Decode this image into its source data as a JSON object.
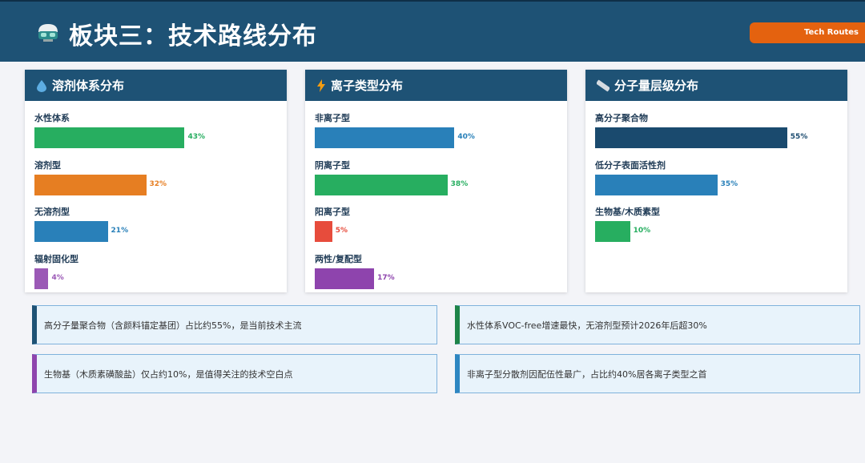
{
  "header": {
    "title": "板块三：技术路线分布",
    "badge": "Tech Routes"
  },
  "cards": [
    {
      "title": "溶剂体系分布",
      "icon": "droplet-icon",
      "items": [
        {
          "label": "水性体系",
          "value": 43,
          "pct": "43%",
          "color": "#27ae60"
        },
        {
          "label": "溶剂型",
          "value": 32,
          "pct": "32%",
          "color": "#e67e22"
        },
        {
          "label": "无溶剂型",
          "value": 21,
          "pct": "21%",
          "color": "#2980b9"
        },
        {
          "label": "辐射固化型",
          "value": 4,
          "pct": "4%",
          "color": "#9b59b6"
        }
      ]
    },
    {
      "title": "离子类型分布",
      "icon": "lightning-icon",
      "items": [
        {
          "label": "非离子型",
          "value": 40,
          "pct": "40%",
          "color": "#2980b9"
        },
        {
          "label": "阴离子型",
          "value": 38,
          "pct": "38%",
          "color": "#27ae60"
        },
        {
          "label": "阳离子型",
          "value": 5,
          "pct": "5%",
          "color": "#e74c3c"
        },
        {
          "label": "两性/复配型",
          "value": 17,
          "pct": "17%",
          "color": "#8e44ad"
        }
      ]
    },
    {
      "title": "分子量层级分布",
      "icon": "ruler-icon",
      "items": [
        {
          "label": "高分子聚合物",
          "value": 55,
          "pct": "55%",
          "color": "#1a4a6e"
        },
        {
          "label": "低分子表面活性剂",
          "value": 35,
          "pct": "35%",
          "color": "#2980b9"
        },
        {
          "label": "生物基/木质素型",
          "value": 10,
          "pct": "10%",
          "color": "#27ae60"
        }
      ]
    }
  ],
  "notes": [
    {
      "text": "高分子量聚合物（含颜料锚定基团）占比约55%，是当前技术主流",
      "color": "#1e5275"
    },
    {
      "text": "水性体系VOC-free增速最快，无溶剂型预计2026年后超30%",
      "color": "#1e8449"
    },
    {
      "text": "生物基（木质素磺酸盐）仅占约10%，是值得关注的技术空白点",
      "color": "#8e44ad"
    },
    {
      "text": "非离子型分散剂因配伍性最广，占比约40%居各离子类型之首",
      "color": "#2e86c1"
    }
  ]
}
